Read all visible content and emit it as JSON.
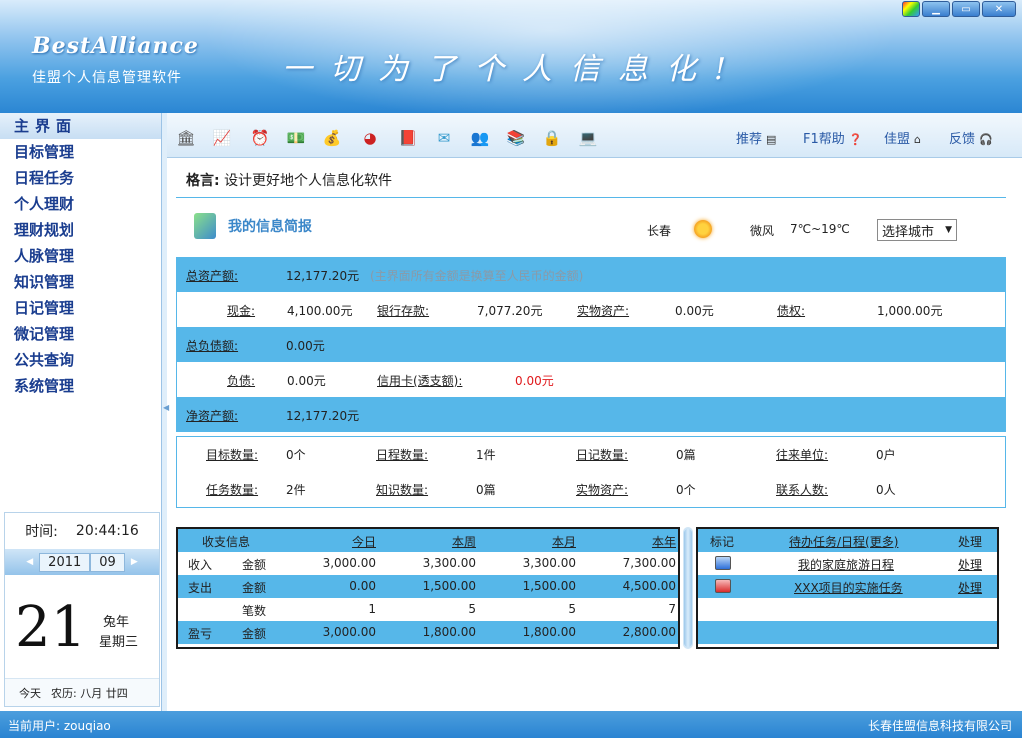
{
  "app": {
    "logo": "BestAlliance",
    "subtitle": "佳盟个人信息管理软件",
    "slogan": "一切为了个人信息化!"
  },
  "window_controls": [
    "skin",
    "minimize",
    "maximize",
    "close"
  ],
  "sidebar": {
    "items": [
      {
        "label": "主界面",
        "active": true
      },
      {
        "label": "目标管理"
      },
      {
        "label": "日程任务"
      },
      {
        "label": "个人理财"
      },
      {
        "label": "理财规划"
      },
      {
        "label": "人脉管理"
      },
      {
        "label": "知识管理"
      },
      {
        "label": "日记管理"
      },
      {
        "label": "微记管理"
      },
      {
        "label": "公共查询"
      },
      {
        "label": "系统管理"
      }
    ]
  },
  "calendar": {
    "time_label": "时间:",
    "time": "20:44:16",
    "year": "2011",
    "month": "09",
    "day": "21",
    "zodiac": "兔年",
    "weekday": "星期三",
    "today_label": "今天",
    "lunar": "农历: 八月 廿四"
  },
  "toolbar": {
    "icons": [
      "bank-icon",
      "chart-icon",
      "clock-icon",
      "wallet-icon",
      "money-bag-icon",
      "pie-chart-icon",
      "book-icon",
      "mail-icon",
      "people-icon",
      "books-icon",
      "lock-icon",
      "computer-icon"
    ],
    "links": {
      "recommend": "推荐",
      "help": "F1帮助",
      "alliance": "佳盟",
      "feedback": "反馈"
    }
  },
  "motto": {
    "label": "格言:",
    "text": "设计更好地个人信息化软件"
  },
  "info": {
    "title": "我的信息简报",
    "city": "长春",
    "wind": "微风",
    "temp": "7℃~19℃",
    "city_select": "选择城市"
  },
  "assets": {
    "total_label": "总资产额:",
    "total_value": "12,177.20元",
    "total_note": "(主界面所有金额是换算至人民币的金额)",
    "cash_label": "现金:",
    "cash_value": "4,100.00元",
    "deposit_label": "银行存款:",
    "deposit_value": "7,077.20元",
    "physical_label": "实物资产:",
    "physical_value": "0.00元",
    "claim_label": "债权:",
    "claim_value": "1,000.00元",
    "liab_total_label": "总负债额:",
    "liab_total_value": "0.00元",
    "debt_label": "负债:",
    "debt_value": "0.00元",
    "credit_label": "信用卡(透支额):",
    "credit_value": "0.00元",
    "net_label": "净资产额:",
    "net_value": "12,177.20元"
  },
  "stats": {
    "goal_label": "目标数量:",
    "goal_value": "0个",
    "schedule_label": "日程数量:",
    "schedule_value": "1件",
    "diary_label": "日记数量:",
    "diary_value": "0篇",
    "unit_label": "往来单位:",
    "unit_value": "0户",
    "task_label": "任务数量:",
    "task_value": "2件",
    "knowledge_label": "知识数量:",
    "knowledge_value": "0篇",
    "physical_label": "实物资产:",
    "physical_value": "0个",
    "contact_label": "联系人数:",
    "contact_value": "0人"
  },
  "income": {
    "headers": [
      "收支信息",
      "今日",
      "本周",
      "本月",
      "本年"
    ],
    "rows": [
      {
        "type": "收入",
        "metric": "金额",
        "today": "3,000.00",
        "week": "3,300.00",
        "month": "3,300.00",
        "year": "7,300.00"
      },
      {
        "type": "支出",
        "metric": "金额",
        "today": "0.00",
        "week": "1,500.00",
        "month": "1,500.00",
        "year": "4,500.00"
      },
      {
        "type": "",
        "metric": "笔数",
        "today": "1",
        "week": "5",
        "month": "5",
        "year": "7"
      },
      {
        "type": "盈亏",
        "metric": "金额",
        "today": "3,000.00",
        "week": "1,800.00",
        "month": "1,800.00",
        "year": "2,800.00"
      }
    ]
  },
  "tasks": {
    "headers": [
      "标记",
      "待办任务/日程(更多)",
      "处理"
    ],
    "rows": [
      {
        "name": "我的家庭旅游日程",
        "action": "处理",
        "tag": "blue"
      },
      {
        "name": "XXX项目的实施任务",
        "action": "处理",
        "tag": "red"
      }
    ]
  },
  "status": {
    "user_label": "当前用户:",
    "user": "zouqiao",
    "company": "长春佳盟信息科技有限公司"
  }
}
